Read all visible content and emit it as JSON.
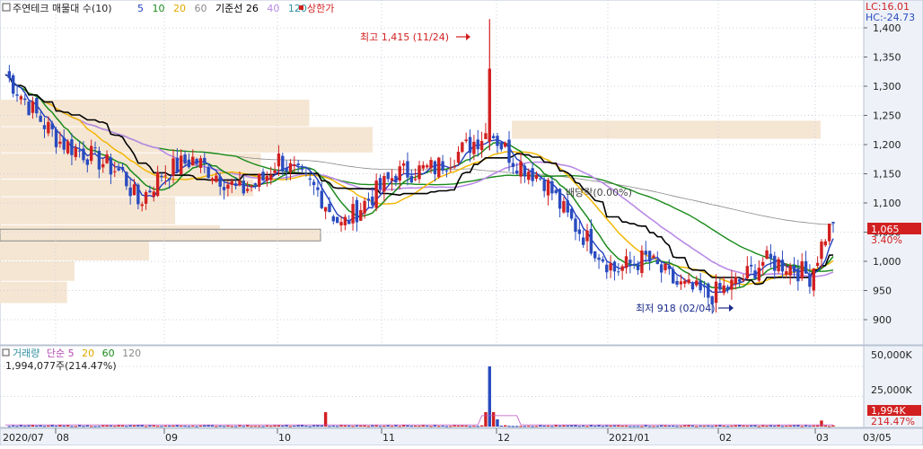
{
  "colors": {
    "up": "#d22020",
    "down": "#2a4bbf",
    "ma5": "#1f3fbf",
    "ma10": "#1a8a1a",
    "ma20": "#f2b705",
    "ma60": "#8a8a8a",
    "ma120": "#b98ae6",
    "kijun": "#000000",
    "vprofile": "#f5e6d3",
    "accent": "#d22020",
    "axis_bg": "#eef2f8",
    "grid": "#c9d1de"
  },
  "header": {
    "box_icon": "checkbox-icon",
    "title": "주연테크 매물대 수(10)",
    "ma_items": [
      {
        "label": "5",
        "color": "#1f3fbf"
      },
      {
        "label": "10",
        "color": "#1a8a1a"
      },
      {
        "label": "20",
        "color": "#e0a800"
      },
      {
        "label": "60",
        "color": "#8a8a8a"
      },
      {
        "label": "기준선 26",
        "color": "#000000"
      },
      {
        "label": "40",
        "color": "#b98ae6"
      },
      {
        "label": "120",
        "color": "#2f8fa0"
      },
      {
        "label": "상한가",
        "color": "#d22020"
      }
    ],
    "lc": "LC:16.01",
    "hc": "HC:-24.73"
  },
  "chart_data": {
    "type": "candlestick",
    "price_axis": {
      "ticks": [
        "1,400",
        "1,350",
        "1,300",
        "1,250",
        "1,200",
        "1,150",
        "1,100",
        "1,050",
        "1,000",
        "950",
        "900"
      ],
      "ylim": [
        860,
        1420
      ]
    },
    "date_labels": [
      "2020/07",
      "08",
      "09",
      "10",
      "11",
      "12",
      "2021/01",
      "02",
      "03",
      "03/05"
    ],
    "annotations": {
      "high": "최고 1,415 (11/24)",
      "low": "최저 918 (02/04)",
      "mid": "배당락(0.00%)"
    },
    "current": {
      "price": "1,065",
      "change": "3.40%"
    },
    "volume": {
      "legend": [
        {
          "label": "거래량",
          "color": "#2f8fa0"
        },
        {
          "label": "단순 5",
          "color": "#b04ab0"
        },
        {
          "label": "20",
          "color": "#e0a800"
        },
        {
          "label": "60",
          "color": "#1a8a1a"
        },
        {
          "label": "120",
          "color": "#8a8a8a"
        }
      ],
      "value_text": "1,994,077주(214.47%)",
      "ticks": [
        "50,000K",
        "25,000K"
      ],
      "ylim": [
        0,
        56000
      ],
      "badge_value": "1,994K",
      "badge_percent": "214.47%"
    },
    "volume_profile": [
      {
        "low": 1230,
        "high": 1277,
        "vol": 0.83
      },
      {
        "low": 1185,
        "high": 1230,
        "vol": 1.0
      },
      {
        "low": 1140,
        "high": 1185,
        "vol": 0.7
      },
      {
        "low": 1110,
        "high": 1140,
        "vol": 0.68
      },
      {
        "low": 1062,
        "high": 1110,
        "vol": 0.47
      },
      {
        "low": 1040,
        "high": 1062,
        "vol": 0.59
      },
      {
        "low": 1000,
        "high": 1040,
        "vol": 0.4
      },
      {
        "low": 965,
        "high": 1000,
        "vol": 0.2
      },
      {
        "low": 927,
        "high": 965,
        "vol": 0.18
      }
    ]
  }
}
